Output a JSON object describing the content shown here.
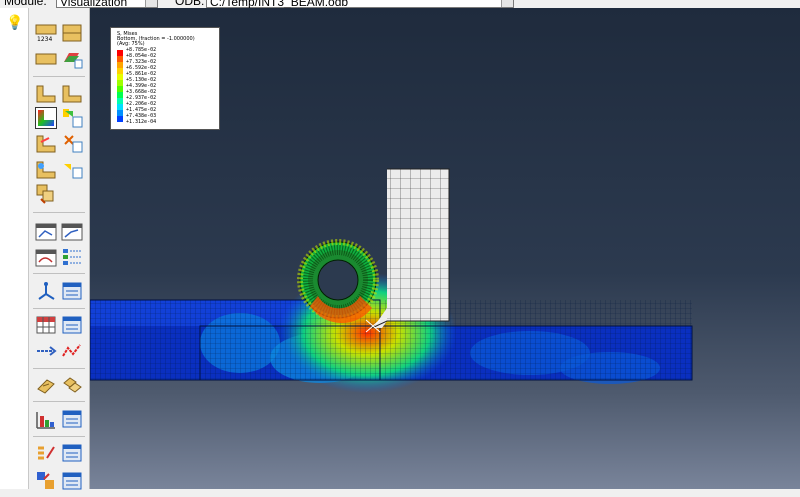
{
  "header": {
    "module_label": "Module:",
    "module_value": "Visualization",
    "odb_label": "ODB:",
    "odb_value": "C:/Temp/INT3_BEAM.odb"
  },
  "toolbox": {
    "icons": [
      "section-points-icon",
      "layer-icon",
      "undeformed-shape-icon",
      "deformed-shape-icon",
      "contour-plot-icon",
      "contour-options-icon",
      "symbol-plot-icon",
      "symbol-options-icon",
      "material-orientation-icon",
      "orientation-options-icon",
      "overlay-plot-icon",
      "animate-scale-icon",
      "animate-time-icon",
      "animate-harmonic-icon",
      "animation-options-icon",
      "xy-data-icon",
      "xy-data-manager-icon",
      "create-path-icon",
      "path-manager-icon",
      "report-field-icon",
      "report-options-icon",
      "probe-values-icon",
      "stream-plot-icon",
      "display-group-icon",
      "group-manager-icon",
      "view-cut-icon",
      "view-cut-manager-icon",
      "free-body-cut-icon",
      "free-body-manager-icon",
      "query-icon",
      "query-manager-icon"
    ]
  },
  "legend": {
    "title1": "S, Mises",
    "title2": "Bottom, (fraction = -1.000000)",
    "title3": "(Avg: 75%)",
    "values": [
      "+8.785e-02",
      "+8.054e-02",
      "+7.323e-02",
      "+6.592e-02",
      "+5.861e-02",
      "+5.130e-02",
      "+4.399e-02",
      "+3.668e-02",
      "+2.937e-02",
      "+2.206e-02",
      "+1.475e-02",
      "+7.438e-03",
      "+1.312e-04"
    ],
    "colors": [
      "#ff0000",
      "#ff5a00",
      "#ffa500",
      "#ffd200",
      "#e6ff00",
      "#a0ff00",
      "#50ff00",
      "#00ff50",
      "#00ffb0",
      "#00e0ff",
      "#0090ff",
      "#0040ff",
      "#0000ff"
    ]
  }
}
